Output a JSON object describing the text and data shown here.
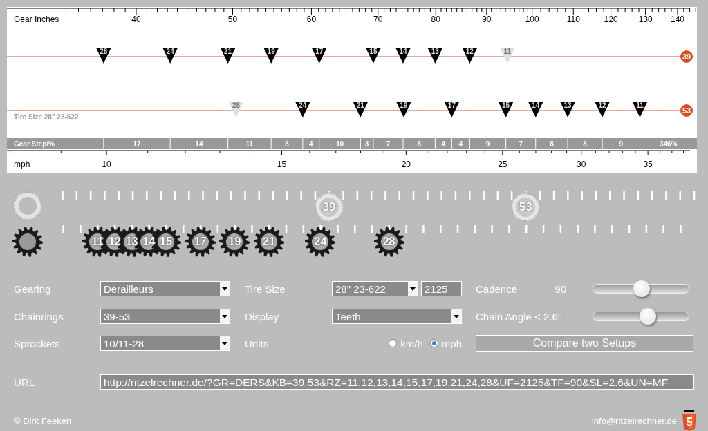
{
  "gear_chart": {
    "axis_label": "Gear Inches",
    "ticks": [
      "40",
      "50",
      "60",
      "70",
      "80",
      "90",
      "100",
      "110",
      "120",
      "130",
      "140"
    ],
    "tire_label": "Tire Size 28\" 23-622",
    "chainrings": [
      {
        "teeth": "39",
        "markers": [
          {
            "label": "28",
            "dimmed": false
          },
          {
            "label": "24",
            "dimmed": false
          },
          {
            "label": "21",
            "dimmed": false
          },
          {
            "label": "19",
            "dimmed": false
          },
          {
            "label": "17",
            "dimmed": false
          },
          {
            "label": "15",
            "dimmed": false
          },
          {
            "label": "14",
            "dimmed": false
          },
          {
            "label": "13",
            "dimmed": false
          },
          {
            "label": "12",
            "dimmed": false
          },
          {
            "label": "11",
            "dimmed": true
          }
        ]
      },
      {
        "teeth": "53",
        "markers": [
          {
            "label": "28",
            "dimmed": true
          },
          {
            "label": "24",
            "dimmed": false
          },
          {
            "label": "21",
            "dimmed": false
          },
          {
            "label": "19",
            "dimmed": false
          },
          {
            "label": "17",
            "dimmed": false
          },
          {
            "label": "15",
            "dimmed": false
          },
          {
            "label": "14",
            "dimmed": false
          },
          {
            "label": "13",
            "dimmed": false
          },
          {
            "label": "12",
            "dimmed": false
          },
          {
            "label": "11",
            "dimmed": false
          }
        ]
      }
    ],
    "gear_step": {
      "label": "Gear Step/%",
      "steps": [
        "17",
        "14",
        "11",
        "8",
        "4",
        "10",
        "3",
        "7",
        "8",
        "4",
        "4",
        "9",
        "7",
        "8",
        "8",
        "9"
      ],
      "total": "346%"
    },
    "speed_axis": {
      "label": "mph",
      "ticks": [
        "10",
        "15",
        "20",
        "25",
        "30",
        "35"
      ]
    }
  },
  "cogs": {
    "chainrings": [
      "39",
      "53"
    ],
    "sprockets": [
      "11",
      "12",
      "13",
      "14",
      "15",
      "17",
      "19",
      "21",
      "24",
      "28"
    ]
  },
  "form": {
    "gearing": {
      "label": "Gearing",
      "value": "Derailleurs"
    },
    "chainrings": {
      "label": "Chainrings",
      "value": "39-53"
    },
    "sprockets": {
      "label": "Sprockets",
      "value": "10/11-28"
    },
    "tire_size": {
      "label": "Tire Size",
      "value": "28\" 23-622",
      "circumference": "2125"
    },
    "display": {
      "label": "Display",
      "value": "Teeth"
    },
    "units": {
      "label": "Units",
      "options": [
        {
          "label": "km/h",
          "selected": false
        },
        {
          "label": "mph",
          "selected": true
        }
      ]
    },
    "cadence": {
      "label": "Cadence",
      "value": "90",
      "level": 0.51
    },
    "chain_angle": {
      "label": "Chain Angle < 2.6°",
      "level": 0.57
    },
    "compare_button": "Compare two Setups"
  },
  "url": {
    "label": "URL",
    "value": "http://ritzelrechner.de/?GR=DERS&KB=39,53&RZ=11,12,13,14,15,17,19,21,24,28&UF=2125&TF=90&SL=2.6&UN=MF"
  },
  "footer": {
    "copyright": "© Dirk Feeken",
    "email": "info@ritzelrechner.de"
  }
}
